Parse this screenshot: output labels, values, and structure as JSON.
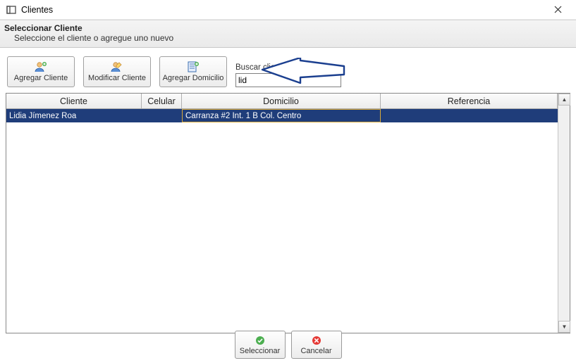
{
  "window": {
    "title": "Clientes"
  },
  "prompt": {
    "header": "Seleccionar Cliente",
    "sub": "Seleccione el cliente o agregue uno nuevo"
  },
  "toolbar": {
    "add_client": "Agregar Cliente",
    "edit_client": "Modificar Cliente",
    "add_address": "Agregar Domicilio"
  },
  "search": {
    "label": "Buscar cliente por",
    "value": "lid"
  },
  "grid": {
    "headers": {
      "cliente": "Cliente",
      "celular": "Celular",
      "domicilio": "Domicilio",
      "referencia": "Referencia"
    },
    "rows": [
      {
        "cliente": "Lidia Jímenez Roa",
        "celular": "",
        "domicilio": "Carranza #2 Int. 1 B Col. Centro",
        "referencia": ""
      }
    ]
  },
  "footer": {
    "select": "Seleccionar",
    "cancel": "Cancelar"
  }
}
